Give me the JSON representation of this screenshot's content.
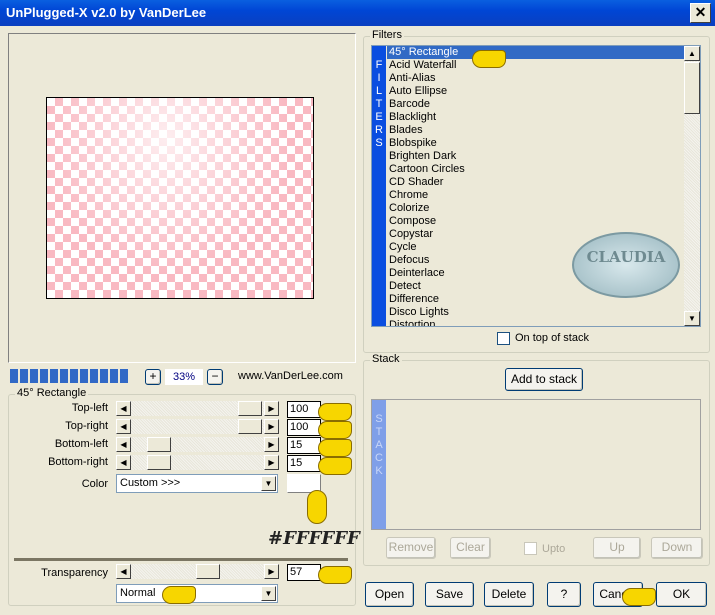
{
  "window": {
    "title": "UnPlugged-X v2.0 by VanDerLee",
    "close": "✕"
  },
  "preview": {
    "zoom": "33%",
    "zoom_in": "+",
    "zoom_out": "−",
    "website": "www.VanDerLee.com",
    "progress_segments": 12
  },
  "params": {
    "group_title": "45° Rectangle",
    "sliders": [
      {
        "label": "Top-left",
        "value": "100"
      },
      {
        "label": "Top-right",
        "value": "100"
      },
      {
        "label": "Bottom-left",
        "value": "15"
      },
      {
        "label": "Bottom-right",
        "value": "15"
      }
    ],
    "color_label": "Color",
    "color_select": "Custom >>>",
    "color_value": "#FFFFFF",
    "color_annotation": "#FFFFFF",
    "transparency_label": "Transparency",
    "transparency_value": "57",
    "blend_mode": "Normal"
  },
  "filters": {
    "group_title": "Filters",
    "strip": "FILTERS",
    "items": [
      "45° Rectangle",
      "Acid Waterfall",
      "Anti-Alias",
      "Auto Ellipse",
      "Barcode",
      "Blacklight",
      "Blades",
      "Blobspike",
      "Brighten Dark",
      "Cartoon Circles",
      "CD Shader",
      "Chrome",
      "Colorize",
      "Compose",
      "Copystar",
      "Cycle",
      "Defocus",
      "Deinterlace",
      "Detect",
      "Difference",
      "Disco Lights",
      "Distortion"
    ],
    "selected": "45° Rectangle",
    "on_top_label": "On top of stack",
    "watermark": "CLAUDIA"
  },
  "stack": {
    "group_title": "Stack",
    "add": "Add to stack",
    "strip": "STACK",
    "remove": "Remove",
    "clear": "Clear",
    "upto": "Upto",
    "up": "Up",
    "down": "Down"
  },
  "footer": {
    "open": "Open",
    "save": "Save",
    "delete": "Delete",
    "help": "?",
    "cancel": "Cancel",
    "ok": "OK"
  },
  "colors": {
    "title_bar": "#0046d5",
    "selection": "#316ac5",
    "strip": "#0a4ee0",
    "checker": "#f9b9c2"
  }
}
